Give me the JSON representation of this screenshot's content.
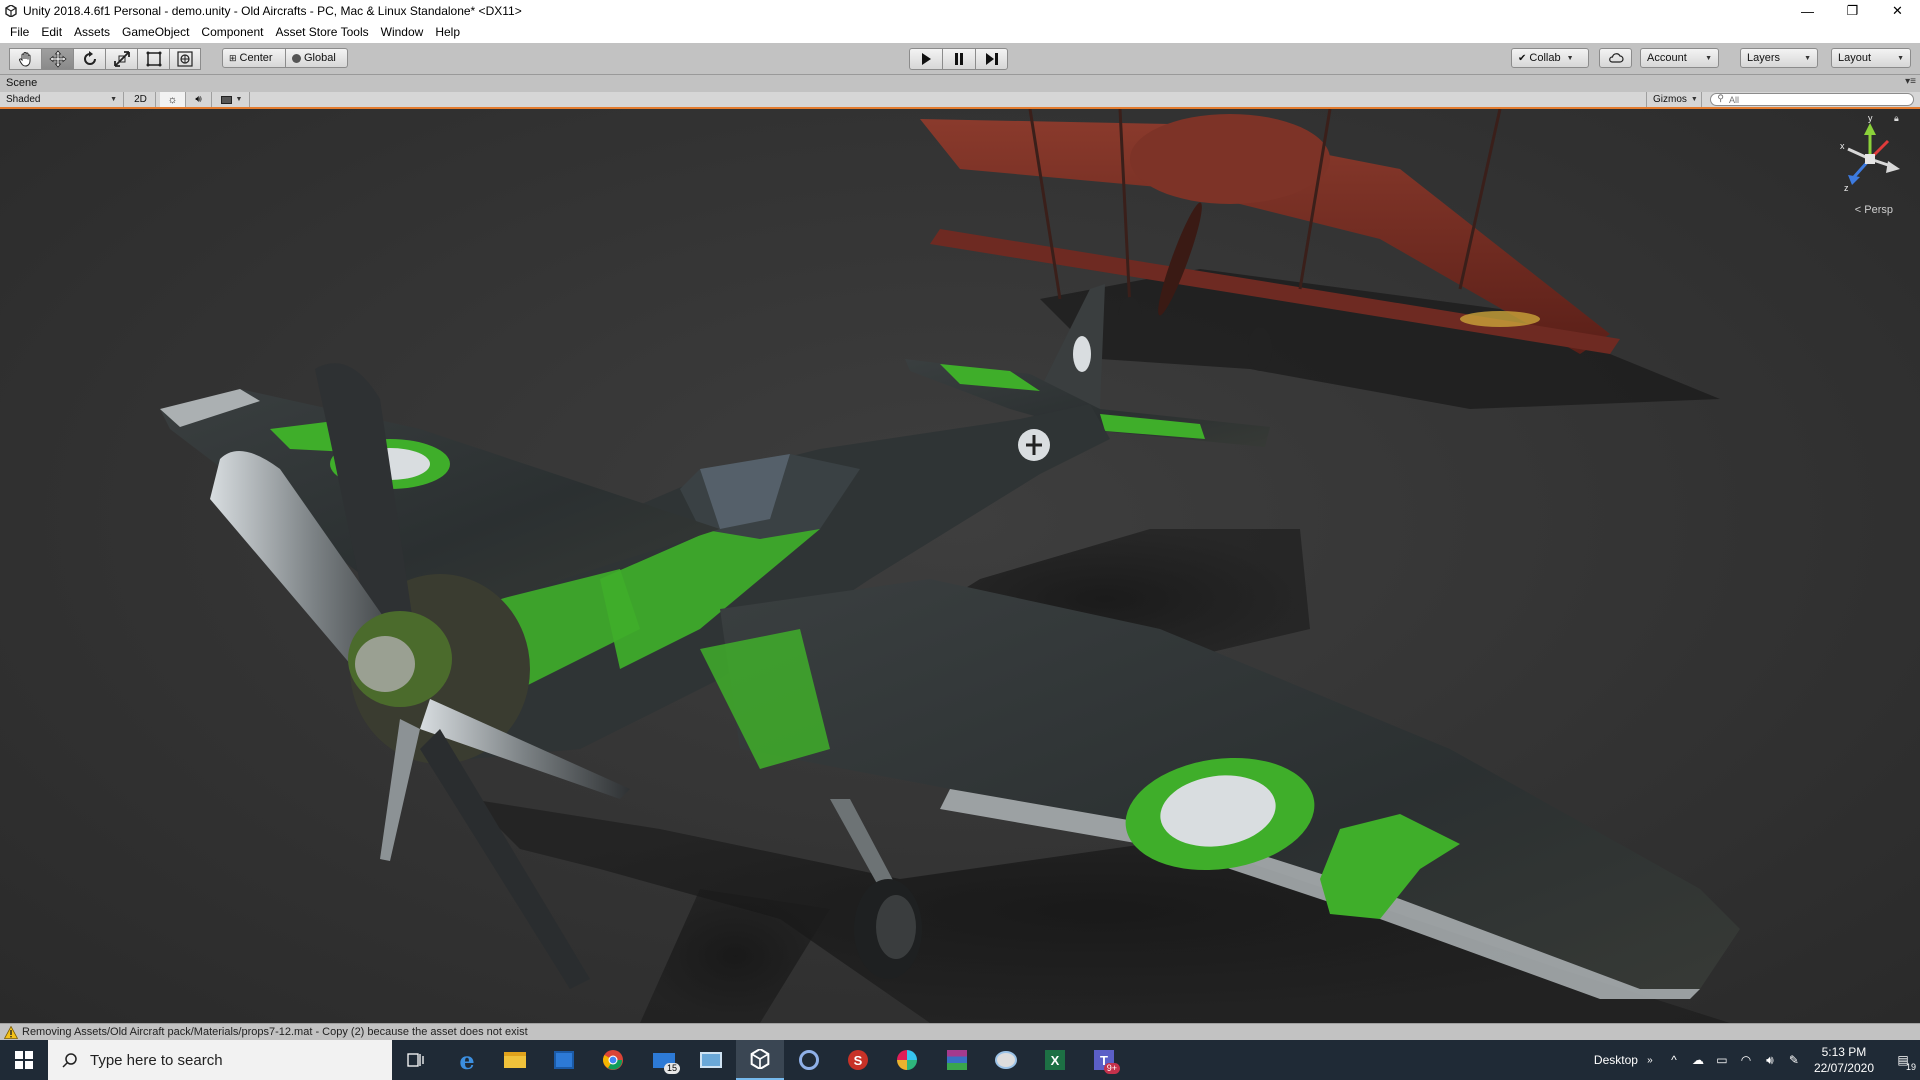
{
  "window": {
    "title": "Unity 2018.4.6f1 Personal - demo.unity - Old Aircrafts - PC, Mac & Linux Standalone* <DX11>",
    "minimize": "—",
    "maximize": "❐",
    "close": "✕"
  },
  "menu": [
    "File",
    "Edit",
    "Assets",
    "GameObject",
    "Component",
    "Asset Store Tools",
    "Window",
    "Help"
  ],
  "toolbar": {
    "tools": [
      "hand-tool",
      "move-tool",
      "rotate-tool",
      "scale-tool",
      "rect-tool",
      "transform-tool"
    ],
    "active_tool": "move-tool",
    "pivot_label": "Center",
    "space_label": "Global",
    "collab_label": "Collab",
    "account_label": "Account",
    "layers_label": "Layers",
    "layout_label": "Layout"
  },
  "scene_tab": {
    "label": "Scene"
  },
  "scene_toolbar": {
    "shading_mode": "Shaded",
    "mode_2d": "2D",
    "gizmos_label": "Gizmos",
    "search_placeholder": "All"
  },
  "viewport": {
    "projection_label": "< Persp",
    "gizmo_y": "y",
    "gizmo_x": "x",
    "gizmo_z": "z"
  },
  "status": {
    "message": "Removing Assets/Old Aircraft pack/Materials/props7-12.mat - Copy (2) because the asset does not exist"
  },
  "taskbar": {
    "search_placeholder": "Type here to search",
    "mail_badge": "15",
    "teams_badge": "9+",
    "desktop_label": "Desktop",
    "time": "5:13 PM",
    "date": "22/07/2020",
    "notification_count": "19"
  },
  "colors": {
    "unity_chrome": "#c2c2c2",
    "accent_orange": "#e37b2e",
    "viewport_bg": "#363636",
    "plane_green": "#3fae2a",
    "plane_dark": "#2b2f30",
    "biplane_red": "#7a2b22",
    "taskbar_bg": "#1f2a36"
  }
}
